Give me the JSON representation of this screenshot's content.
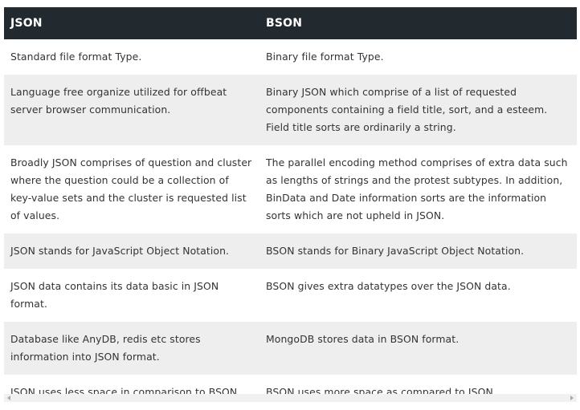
{
  "header": {
    "col1": "JSON",
    "col2": "BSON"
  },
  "rows": [
    {
      "json": "Standard file format Type.",
      "bson": "Binary file format Type."
    },
    {
      "json": "Language free organize utilized for offbeat server browser communication.",
      "bson": "Binary JSON which comprise of a list of requested components containing a field title, sort, and a esteem. Field title sorts are ordinarily a string."
    },
    {
      "json": "Broadly JSON comprises of question and cluster where the question could be a collection of key-value sets and the cluster is requested list of values.",
      "bson": "The parallel encoding method comprises of extra data such as lengths of strings and the protest subtypes. In addition, BinData and Date information sorts are the information sorts which are not upheld in JSON."
    },
    {
      "json": "JSON stands for JavaScript Object Notation.",
      "bson": "BSON stands for Binary JavaScript Object Notation."
    },
    {
      "json": "JSON data contains its data basic in JSON format.",
      "bson": "BSON gives extra datatypes over the JSON data."
    },
    {
      "json": "Database like AnyDB, redis etc stores information into JSON format.",
      "bson": "MongoDB stores data in BSON format."
    },
    {
      "json": "JSON uses less space in comparison to BSON.",
      "bson": "BSON uses more space as compared to JSON."
    }
  ],
  "icons": {
    "scroll_left": "chevron-left-icon",
    "scroll_right": "chevron-right-icon"
  }
}
